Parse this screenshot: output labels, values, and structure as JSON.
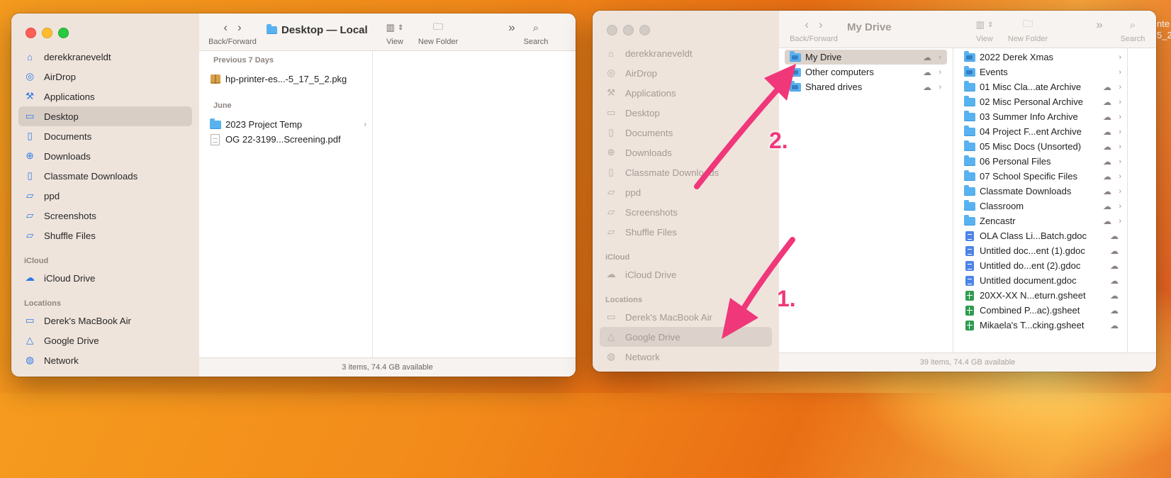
{
  "desktop_window": {
    "title": "Desktop — Local",
    "toolbar": {
      "back_forward_label": "Back/Forward",
      "view_label": "View",
      "new_folder_label": "New Folder",
      "search_label": "Search"
    },
    "sidebar": {
      "favorites": [
        {
          "label": "derekkraneveldt",
          "icon": "home-icon"
        },
        {
          "label": "AirDrop",
          "icon": "airdrop-icon"
        },
        {
          "label": "Applications",
          "icon": "applications-icon"
        },
        {
          "label": "Desktop",
          "icon": "desktop-icon",
          "selected": true
        },
        {
          "label": "Documents",
          "icon": "document-icon"
        },
        {
          "label": "Downloads",
          "icon": "downloads-icon"
        },
        {
          "label": "Classmate Downloads",
          "icon": "document-icon"
        },
        {
          "label": "ppd",
          "icon": "folder-icon"
        },
        {
          "label": "Screenshots",
          "icon": "folder-icon"
        },
        {
          "label": "Shuffle Files",
          "icon": "folder-icon"
        }
      ],
      "icloud_header": "iCloud",
      "icloud_items": [
        {
          "label": "iCloud Drive",
          "icon": "cloud-icon"
        }
      ],
      "locations_header": "Locations",
      "location_items": [
        {
          "label": "Derek's MacBook Air",
          "icon": "laptop-icon"
        },
        {
          "label": "Google Drive",
          "icon": "drive-icon"
        },
        {
          "label": "Network",
          "icon": "network-icon"
        }
      ]
    },
    "groups": [
      {
        "header": "Previous 7 Days",
        "items": [
          {
            "name": "hp-printer-es...-5_17_5_2.pkg",
            "type": "pkg"
          }
        ]
      },
      {
        "header": "June",
        "items": [
          {
            "name": "2023 Project Temp",
            "type": "folder",
            "chevron": true
          },
          {
            "name": "OG 22-3199...Screening.pdf",
            "type": "pdf"
          }
        ]
      }
    ],
    "status": "3 items, 74.4 GB available"
  },
  "drive_window": {
    "title": "My Drive",
    "toolbar": {
      "back_forward_label": "Back/Forward",
      "view_label": "View",
      "new_folder_label": "New Folder",
      "search_label": "Search"
    },
    "sidebar": {
      "favorites": [
        {
          "label": "derekkraneveldt",
          "icon": "home-icon"
        },
        {
          "label": "AirDrop",
          "icon": "airdrop-icon"
        },
        {
          "label": "Applications",
          "icon": "applications-icon"
        },
        {
          "label": "Desktop",
          "icon": "desktop-icon"
        },
        {
          "label": "Documents",
          "icon": "document-icon"
        },
        {
          "label": "Downloads",
          "icon": "downloads-icon"
        },
        {
          "label": "Classmate Downloads",
          "icon": "document-icon"
        },
        {
          "label": "ppd",
          "icon": "folder-icon"
        },
        {
          "label": "Screenshots",
          "icon": "folder-icon"
        },
        {
          "label": "Shuffle Files",
          "icon": "folder-icon"
        }
      ],
      "icloud_header": "iCloud",
      "icloud_items": [
        {
          "label": "iCloud Drive",
          "icon": "cloud-icon"
        }
      ],
      "locations_header": "Locations",
      "location_items": [
        {
          "label": "Derek's MacBook Air",
          "icon": "laptop-icon"
        },
        {
          "label": "Google Drive",
          "icon": "drive-icon",
          "selected": true
        },
        {
          "label": "Network",
          "icon": "network-icon"
        }
      ]
    },
    "column1": [
      {
        "name": "My Drive",
        "type": "folder-drive",
        "selected": true
      },
      {
        "name": "Other computers",
        "type": "folder-drive"
      },
      {
        "name": "Shared drives",
        "type": "folder-drive"
      }
    ],
    "column2": [
      {
        "name": "2022 Derek Xmas",
        "type": "folder-drive",
        "cloud": false
      },
      {
        "name": "Events",
        "type": "folder-drive",
        "cloud": false
      },
      {
        "name": "01 Misc Cla...ate Archive",
        "type": "folder",
        "cloud": true
      },
      {
        "name": "02 Misc Personal Archive",
        "type": "folder",
        "cloud": true
      },
      {
        "name": "03 Summer Info Archive",
        "type": "folder",
        "cloud": true
      },
      {
        "name": "04 Project F...ent Archive",
        "type": "folder",
        "cloud": true
      },
      {
        "name": "05 Misc Docs (Unsorted)",
        "type": "folder",
        "cloud": true
      },
      {
        "name": "06 Personal Files",
        "type": "folder",
        "cloud": true
      },
      {
        "name": "07 School Specific Files",
        "type": "folder",
        "cloud": true
      },
      {
        "name": "Classmate Downloads",
        "type": "folder",
        "cloud": true
      },
      {
        "name": "Classroom",
        "type": "folder",
        "cloud": true
      },
      {
        "name": "Zencastr",
        "type": "folder",
        "cloud": true
      },
      {
        "name": "OLA Class Li...Batch.gdoc",
        "type": "gdoc",
        "cloud": true
      },
      {
        "name": "Untitled doc...ent (1).gdoc",
        "type": "gdoc",
        "cloud": true
      },
      {
        "name": "Untitled do...ent (2).gdoc",
        "type": "gdoc",
        "cloud": true
      },
      {
        "name": "Untitled document.gdoc",
        "type": "gdoc",
        "cloud": true
      },
      {
        "name": "20XX-XX N...eturn.gsheet",
        "type": "gsheet",
        "cloud": true
      },
      {
        "name": "Combined P...ac).gsheet",
        "type": "gsheet",
        "cloud": true
      },
      {
        "name": "Mikaela's T...cking.gsheet",
        "type": "gsheet",
        "cloud": true
      }
    ],
    "status": "39 items, 74.4 GB available"
  },
  "annotations": {
    "step1": "1.",
    "step2": "2.",
    "arrow_color": "#f0377a"
  },
  "background_peek": "nte\n5_2"
}
